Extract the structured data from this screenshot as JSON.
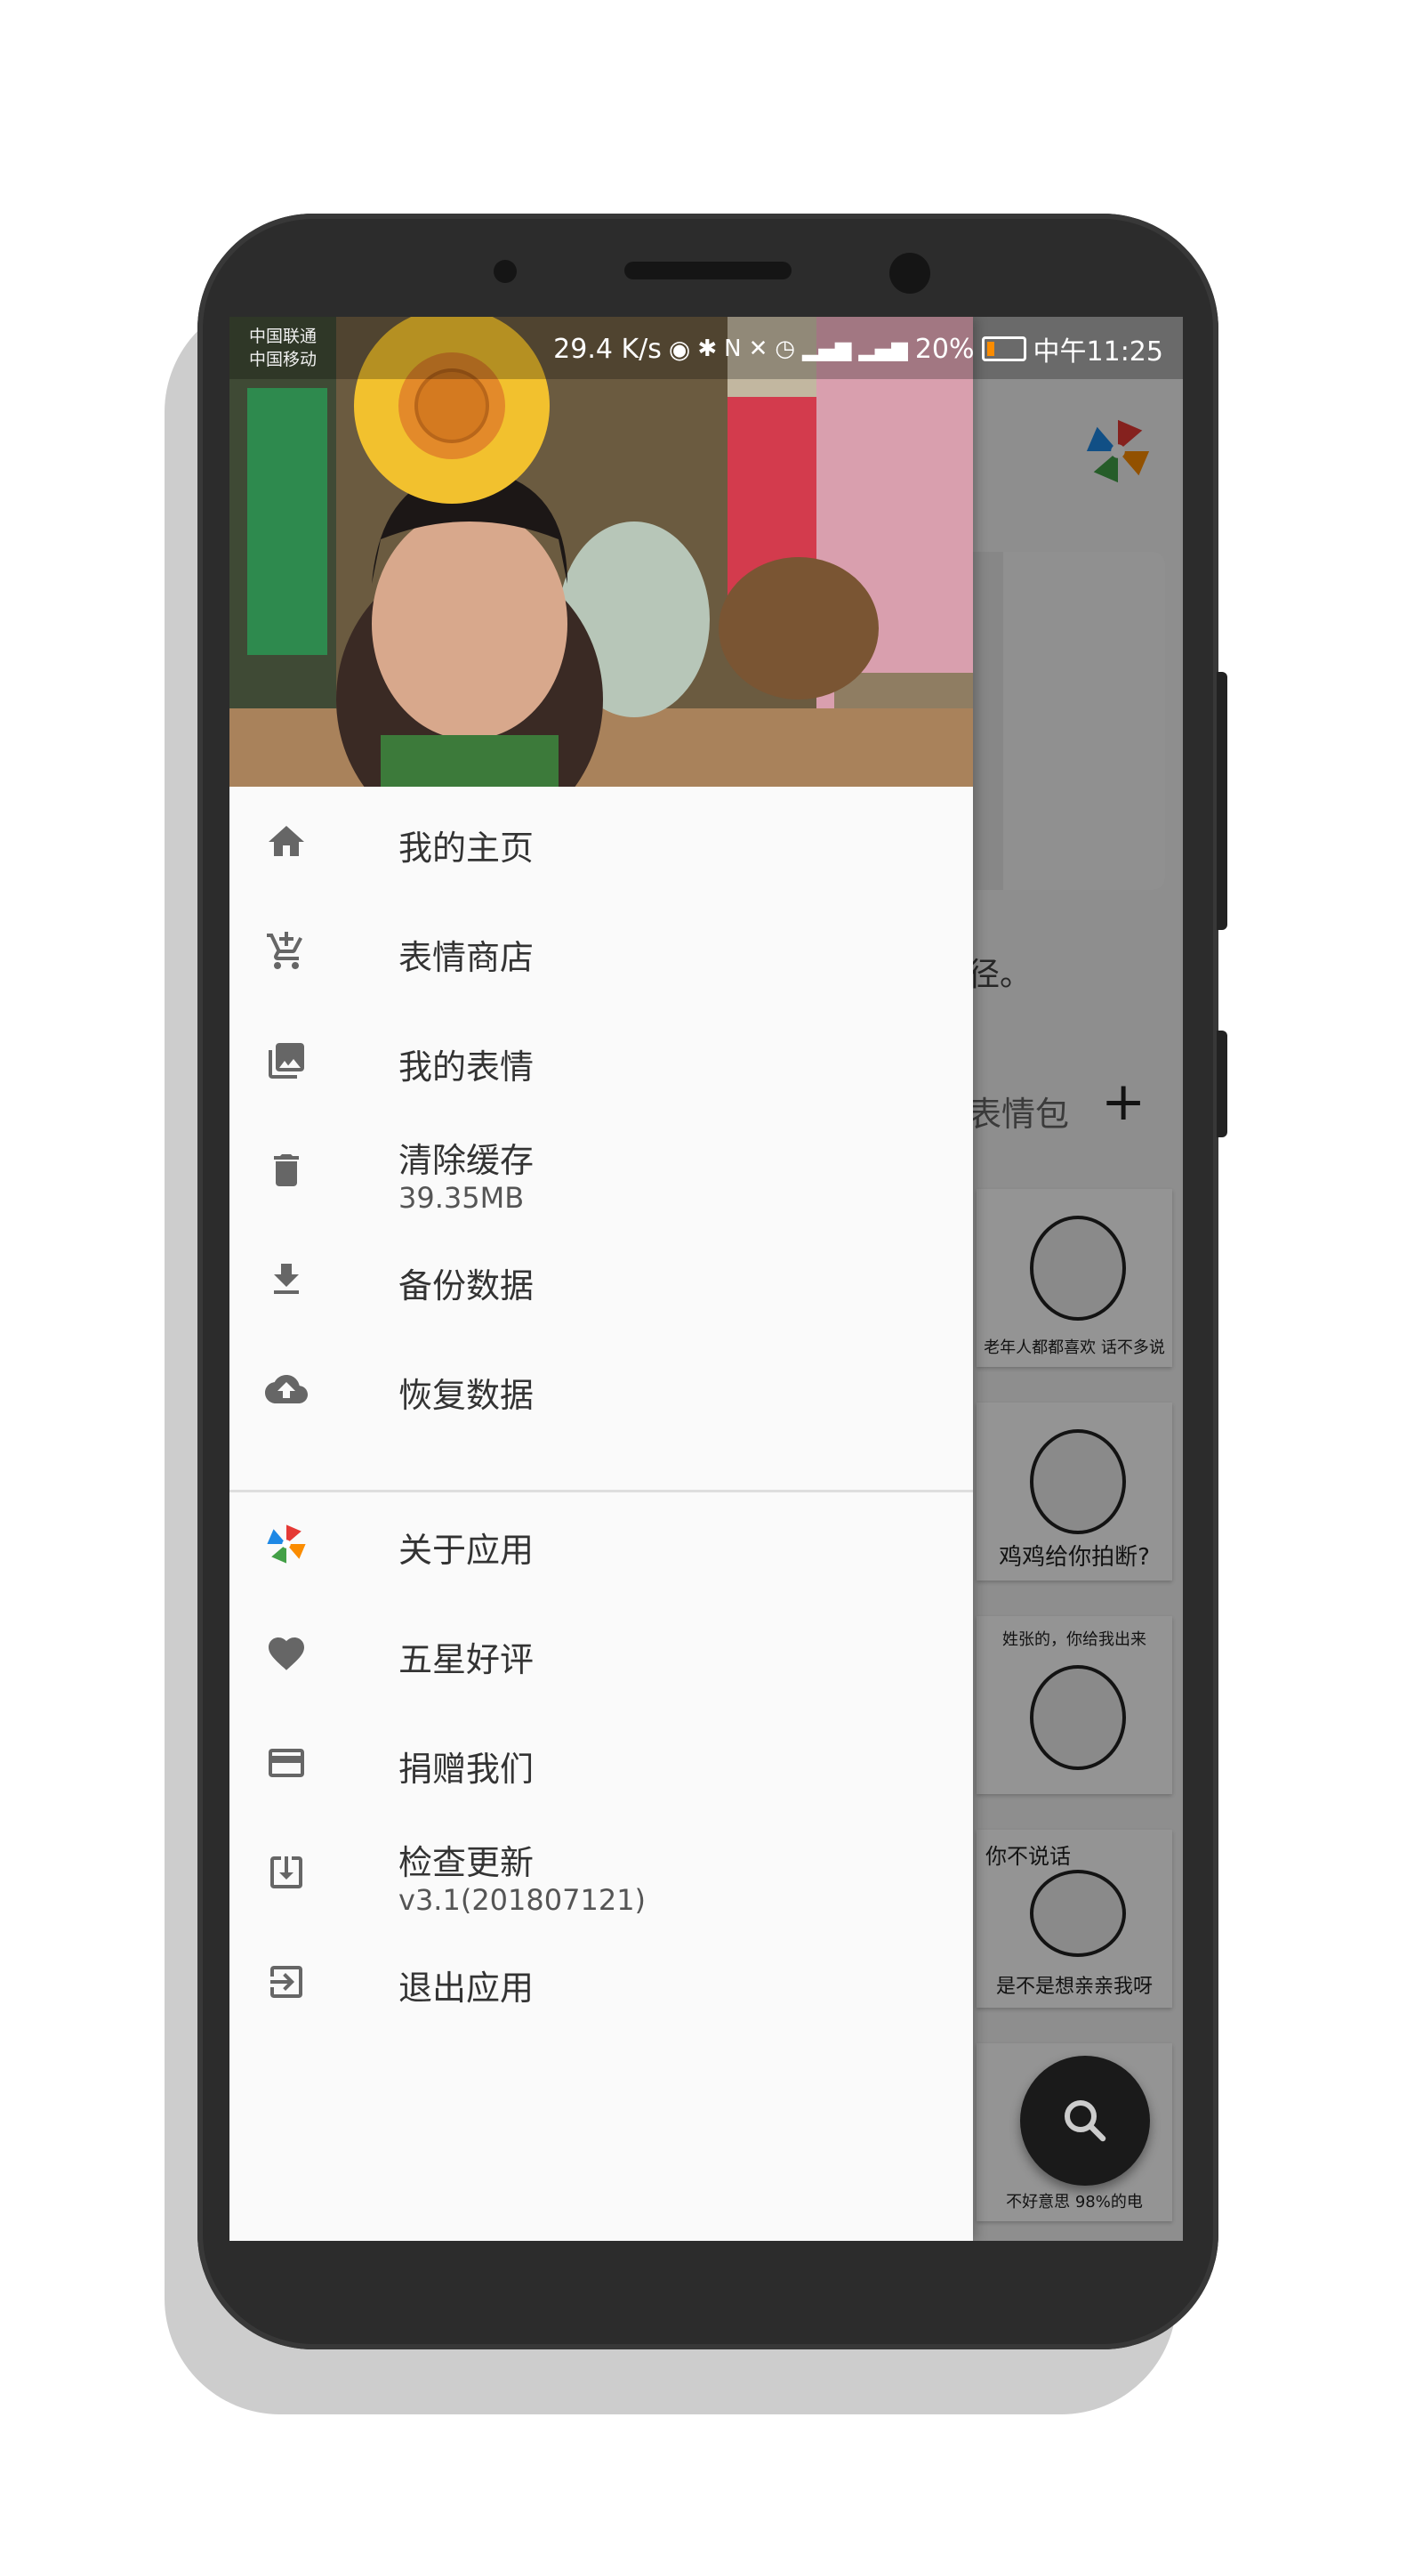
{
  "status_bar": {
    "carrier_1": "中国联通",
    "carrier_2": "中国移动",
    "net_speed": "29.4 K/s",
    "battery": "20%",
    "time": "中午11:25"
  },
  "background": {
    "partial_text": "径。",
    "tab_label": "表情包",
    "add_label": "+",
    "stickers": [
      {
        "caption": "老年人都都喜欢 话不多说"
      },
      {
        "caption": "鸡鸡给你拍断?"
      },
      {
        "caption": "姓张的，你给我出来"
      },
      {
        "caption": "是不是想亲亲我呀",
        "top_text": "你不说话"
      },
      {
        "caption": "不好意思 98%的电"
      }
    ]
  },
  "drawer": {
    "items": [
      {
        "label": "我的主页",
        "icon": "home-icon"
      },
      {
        "label": "表情商店",
        "icon": "cart-icon"
      },
      {
        "label": "我的表情",
        "icon": "photo-library-icon"
      },
      {
        "label": "清除缓存",
        "sub": "39.35MB",
        "icon": "trash-icon"
      },
      {
        "label": "备份数据",
        "icon": "download-icon"
      },
      {
        "label": "恢复数据",
        "icon": "cloud-upload-icon"
      },
      {
        "label": "关于应用",
        "icon": "app-logo-icon"
      },
      {
        "label": "五星好评",
        "icon": "heart-icon"
      },
      {
        "label": "捐赠我们",
        "icon": "credit-card-icon"
      },
      {
        "label": "检查更新",
        "sub": "v3.1(201807121)",
        "icon": "update-icon"
      },
      {
        "label": "退出应用",
        "icon": "exit-icon"
      }
    ]
  },
  "colors": {
    "drawer_bg": "#fafafa",
    "icon": "#666666",
    "text": "#333333",
    "fab": "#1a1a1a"
  }
}
